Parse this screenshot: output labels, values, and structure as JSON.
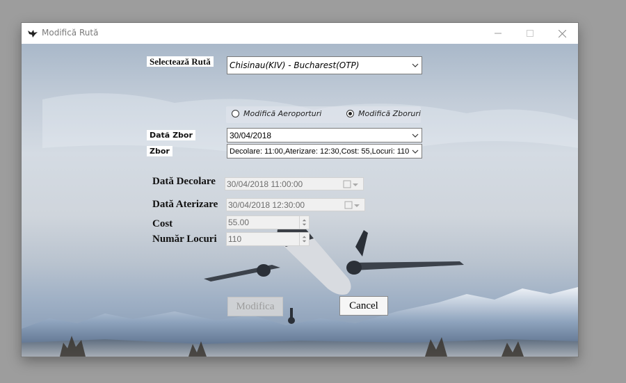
{
  "window": {
    "title": "Modifică Rută",
    "icon": "bird-icon",
    "controls": [
      "minimize-icon",
      "maximize-icon",
      "close-icon"
    ]
  },
  "form": {
    "route_label": "Selectează Rută",
    "route_value": "Chisinau(KIV) - Bucharest(OTP)",
    "radio_airports": "Modifică Aeroporturi",
    "radio_flights": "Modifică Zboruri",
    "radio_selected": "flights",
    "date_label": "Dată Zbor",
    "date_value": "30/04/2018",
    "flight_label": "Zbor",
    "flight_value": "Decolare: 11:00,Aterizare: 12:30,Cost: 55,Locuri: 110",
    "takeoff_label": "Dată Decolare",
    "takeoff_value": "30/04/2018 11:00:00",
    "landing_label": "Dată Aterizare",
    "landing_value": "30/04/2018 12:30:00",
    "cost_label": "Cost",
    "cost_value": "55.00",
    "seats_label": "Număr Locuri",
    "seats_value": "110"
  },
  "buttons": {
    "modify": "Modifica",
    "cancel": "Cancel"
  }
}
